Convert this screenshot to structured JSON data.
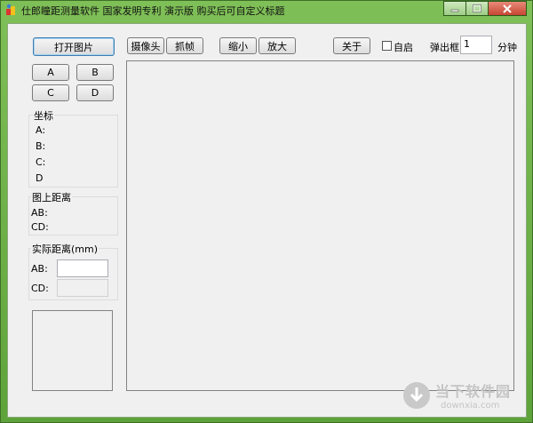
{
  "window": {
    "title": "仕郎瞳距测量软件 国家发明专利 演示版 购买后可自定义标题"
  },
  "buttons": {
    "open_image": "打开图片",
    "a": "A",
    "b": "B",
    "c": "C",
    "d": "D",
    "camera": "摄像头",
    "capture": "抓帧",
    "zoom_out": "缩小",
    "zoom_in": "放大",
    "about": "关于"
  },
  "toolbar": {
    "autostart_label": "自启",
    "popup_label": "弹出框",
    "popup_value": "1",
    "minutes_label": "分钟"
  },
  "coords": {
    "title": "坐标",
    "a": "A:",
    "b": "B:",
    "c": "C:",
    "d": "D"
  },
  "image_distance": {
    "title": "图上距离",
    "ab": "AB:",
    "cd": "CD:"
  },
  "real_distance": {
    "title": "实际距离(mm)",
    "ab": "AB:",
    "cd": "CD:",
    "ab_value": "",
    "cd_value": ""
  },
  "watermark": {
    "name": "当下软件园",
    "url": "downxia.com"
  }
}
